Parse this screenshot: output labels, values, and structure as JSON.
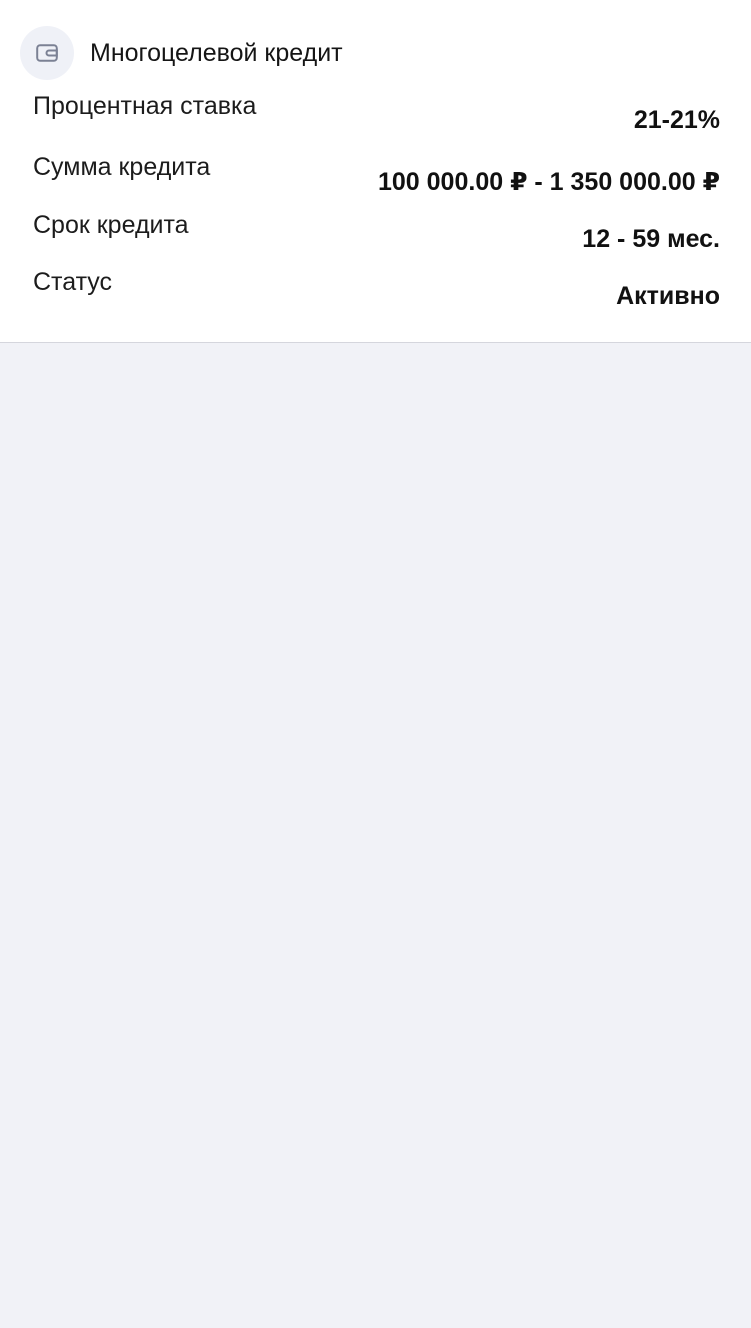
{
  "loan": {
    "title": "Многоцелевой кредит",
    "icon": "wallet-icon",
    "rows": [
      {
        "label": "Процентная ставка",
        "value": "21-21%"
      },
      {
        "label": "Сумма кредита",
        "value": "100 000.00 ₽ - 1 350 000.00 ₽"
      },
      {
        "label": "Срок кредита",
        "value": "12 - 59 мес."
      },
      {
        "label": "Статус",
        "value": "Активно"
      }
    ]
  },
  "colors": {
    "page_background": "#f1f2f7",
    "card_background": "#ffffff",
    "icon_background": "#eff1f7",
    "icon_stroke": "#7b8194"
  }
}
